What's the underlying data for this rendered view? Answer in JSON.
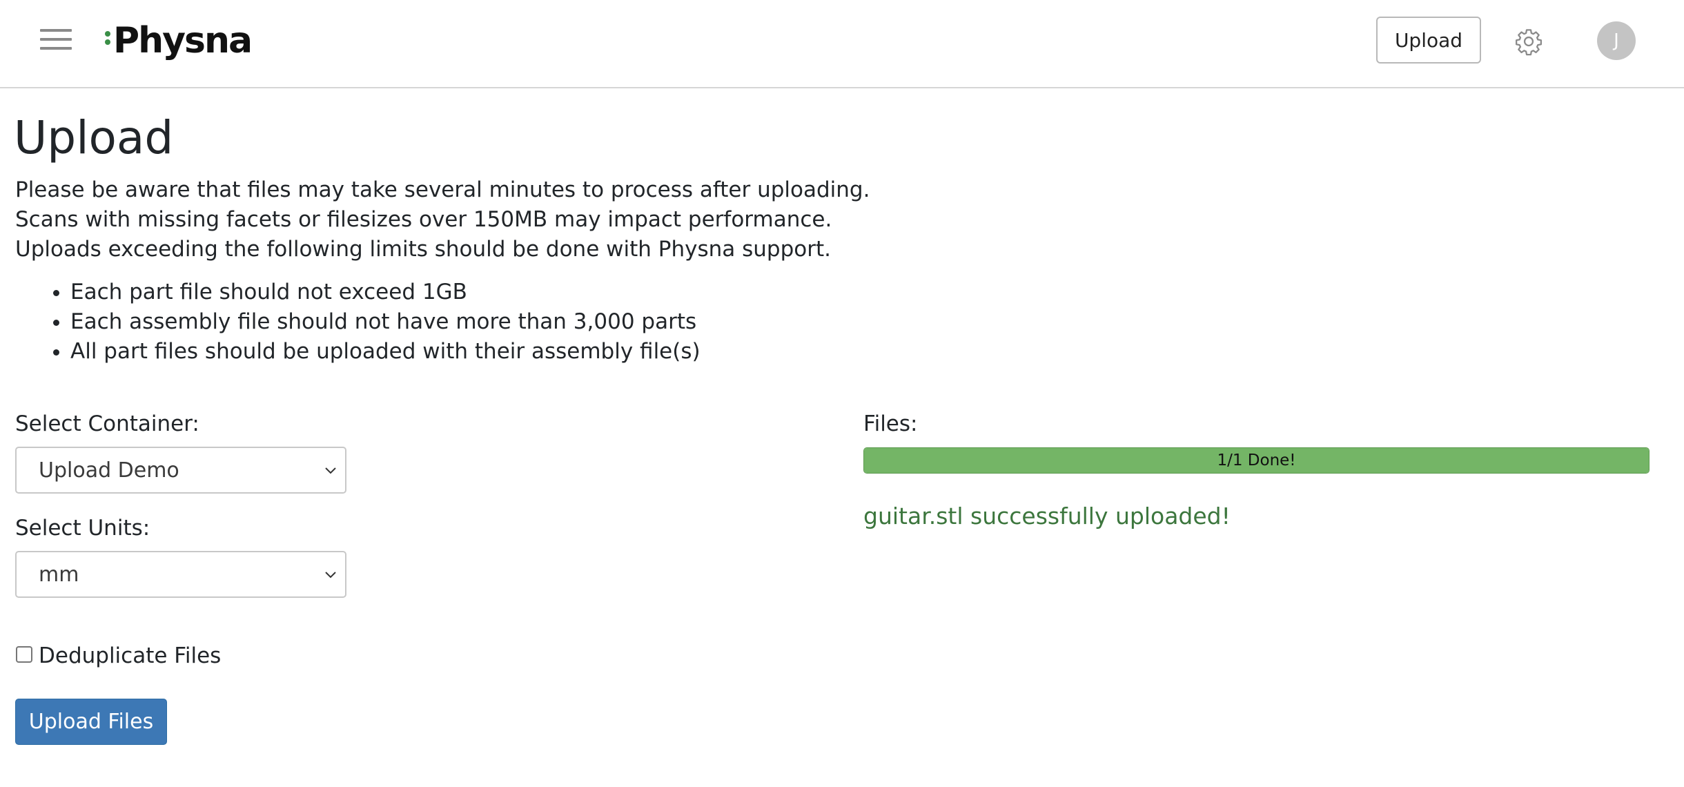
{
  "header": {
    "logo_text": "Physna",
    "upload_button": "Upload",
    "avatar_initial": "J",
    "icons": {
      "menu": "hamburger-menu-icon",
      "settings": "gear-icon"
    }
  },
  "main": {
    "title": "Upload",
    "notice_lines": [
      "Please be aware that files may take several minutes to process after uploading.",
      "Scans with missing facets or filesizes over 150MB may impact performance.",
      "Uploads exceeding the following limits should be done with Physna support."
    ],
    "limits": [
      "Each part file should not exceed 1GB",
      "Each assembly file should not have more than 3,000 parts",
      "All part files should be uploaded with their assembly file(s)"
    ],
    "container": {
      "label": "Select Container:",
      "selected": "Upload Demo"
    },
    "units": {
      "label": "Select Units:",
      "selected": "mm"
    },
    "deduplicate": {
      "label": "Deduplicate Files",
      "checked": false
    },
    "upload_files_button": "Upload Files"
  },
  "files": {
    "label": "Files:",
    "progress_text": "1/1 Done!",
    "progress_fraction": 1.0,
    "success_message": "guitar.stl successfully uploaded!"
  },
  "colors": {
    "brand_green": "#3a8f47",
    "progress_green": "#74b566",
    "success_text": "#3c763d",
    "primary_button": "#3d78b5"
  }
}
